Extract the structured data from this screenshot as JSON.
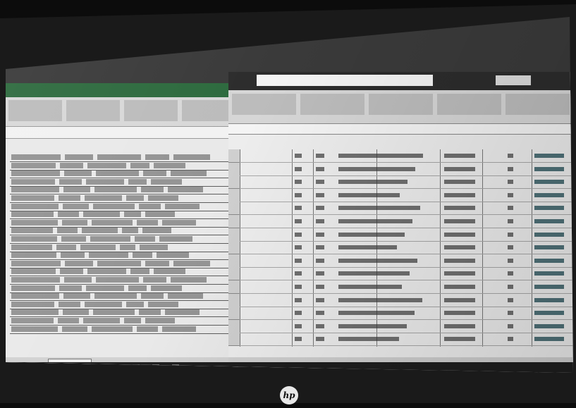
{
  "page": {
    "title": ""
  },
  "left_window": {
    "title": "",
    "sheet_tab": ""
  },
  "right_window": {
    "title": "",
    "search_text": "",
    "user_label": ""
  },
  "taskbar": {
    "icons": [
      "start-icon",
      "search-icon",
      "task-view-icon",
      "explorer-icon",
      "edge-icon",
      "excel-icon",
      "excel-icon",
      "app-icon"
    ]
  },
  "brand": {
    "logo": "hp-logo",
    "color": "#e8e8e8"
  }
}
